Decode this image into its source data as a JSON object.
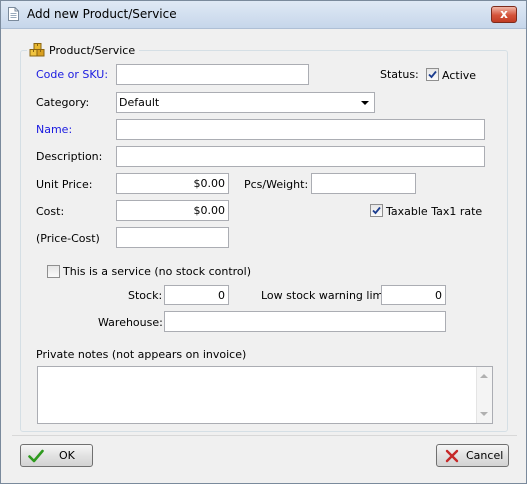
{
  "window": {
    "title": "Add new Product/Service",
    "close_glyph": "x"
  },
  "group": {
    "title": "Product/Service",
    "icon": "boxes-icon"
  },
  "fields": {
    "code_label": "Code or SKU:",
    "code_value": "",
    "status_label": "Status:",
    "active_label": "Active",
    "active_checked": true,
    "category_label": "Category:",
    "category_value": "Default",
    "name_label": "Name:",
    "name_value": "",
    "description_label": "Description:",
    "description_value": "",
    "unit_price_label": "Unit Price:",
    "unit_price_value": "$0.00",
    "pcs_weight_label": "Pcs/Weight:",
    "pcs_weight_value": "",
    "cost_label": "Cost:",
    "cost_value": "$0.00",
    "taxable_label": "Taxable Tax1 rate",
    "taxable_checked": true,
    "price_cost_label": "(Price-Cost)",
    "price_cost_value": "",
    "service_label": "This is a service (no stock control)",
    "service_checked": false,
    "stock_label": "Stock:",
    "stock_value": "0",
    "low_stock_label": "Low stock warning limit:",
    "low_stock_value": "0",
    "warehouse_label": "Warehouse:",
    "warehouse_value": "",
    "notes_label": "Private notes (not appears on invoice)",
    "notes_value": ""
  },
  "buttons": {
    "ok_label": "OK",
    "cancel_label": "Cancel"
  },
  "colors": {
    "required_label": "#1a1ae0",
    "ok_check": "#2e9a1e",
    "cancel_x": "#c62828"
  }
}
